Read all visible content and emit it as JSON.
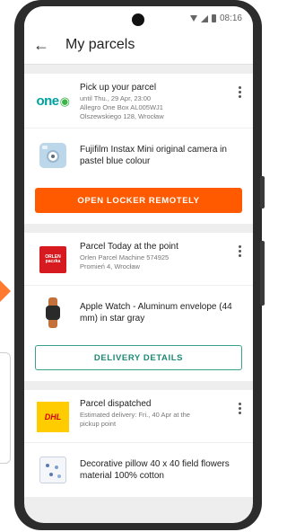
{
  "status_bar": {
    "time": "08:16"
  },
  "header": {
    "back_icon": "arrow-left-icon",
    "title": "My parcels"
  },
  "parcels": [
    {
      "carrier_logo": {
        "text": "one",
        "icon": "one-logo-icon"
      },
      "title": "Pick up your parcel",
      "lines": [
        "until Thu., 29 Apr, 23:00",
        "Allegro One Box AL005WJ1",
        "Olszewskiego 128, Wrocław"
      ],
      "item": "Fujifilm Instax Mini  original camera in pastel blue colour",
      "action": "OPEN LOCKER REMOTELY"
    },
    {
      "carrier_logo": {
        "line1": "ORLEN",
        "line2": "paczka",
        "icon": "orlen-logo-icon"
      },
      "title": "Parcel Today at the point",
      "lines": [
        "Orlen Parcel Machine 574925",
        "Promień 4, Wrocław"
      ],
      "item": "Apple Watch - Aluminum envelope (44 mm) in star gray",
      "action": "DELIVERY DETAILS"
    },
    {
      "carrier_logo": {
        "text": "DHL",
        "icon": "dhl-logo-icon"
      },
      "title": "Parcel dispatched",
      "lines": [
        "Estimated delivery: Fri., 40 Apr at the",
        "pickup point"
      ],
      "item": "Decorative pillow 40 x 40 field flowers material 100% cotton"
    }
  ],
  "colors": {
    "primary_orange": "#ff5a00",
    "outline_green": "#1c8a72"
  }
}
